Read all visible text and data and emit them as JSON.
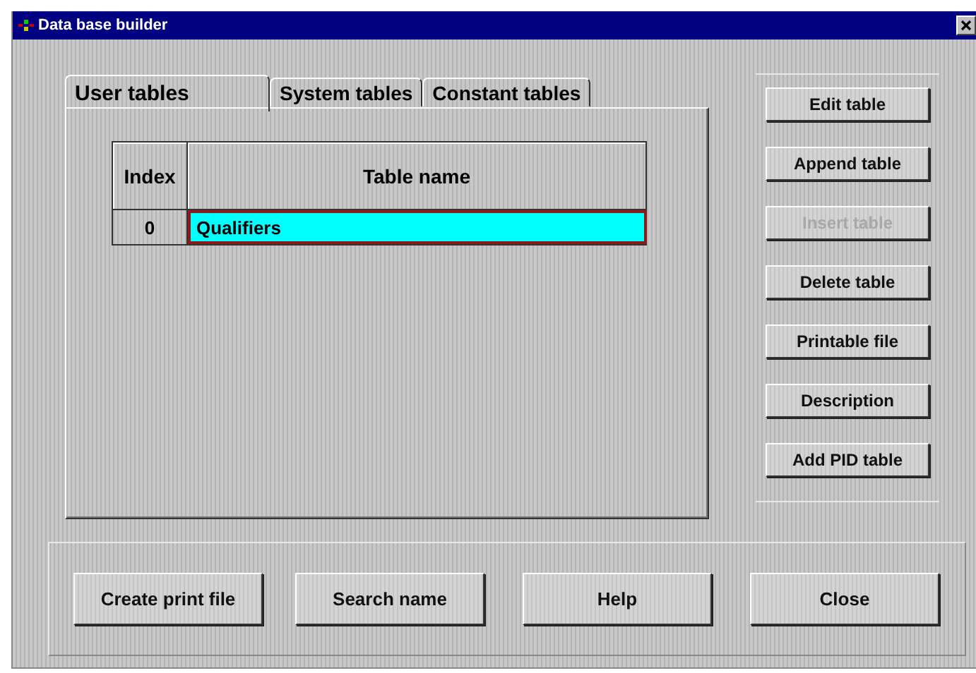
{
  "window": {
    "title": "Data base builder"
  },
  "tabs": [
    {
      "label": "User tables",
      "selected": true
    },
    {
      "label": "System tables",
      "selected": false
    },
    {
      "label": "Constant tables",
      "selected": false
    }
  ],
  "table": {
    "columns": [
      "Index",
      "Table name"
    ],
    "rows": [
      {
        "cells": [
          "0",
          "Qualifiers"
        ],
        "selected": true
      }
    ]
  },
  "side_buttons": [
    {
      "label": "Edit table",
      "disabled": false
    },
    {
      "label": "Append table",
      "disabled": false
    },
    {
      "label": "Insert table",
      "disabled": true
    },
    {
      "label": "Delete table",
      "disabled": false
    },
    {
      "label": "Printable file",
      "disabled": false
    },
    {
      "label": "Description",
      "disabled": false
    },
    {
      "label": "Add PID table",
      "disabled": false
    }
  ],
  "bottom_buttons": [
    {
      "label": "Create print file",
      "disabled": false
    },
    {
      "label": "Search name",
      "disabled": false
    },
    {
      "label": "Help",
      "disabled": false
    },
    {
      "label": "Close",
      "disabled": false
    }
  ]
}
